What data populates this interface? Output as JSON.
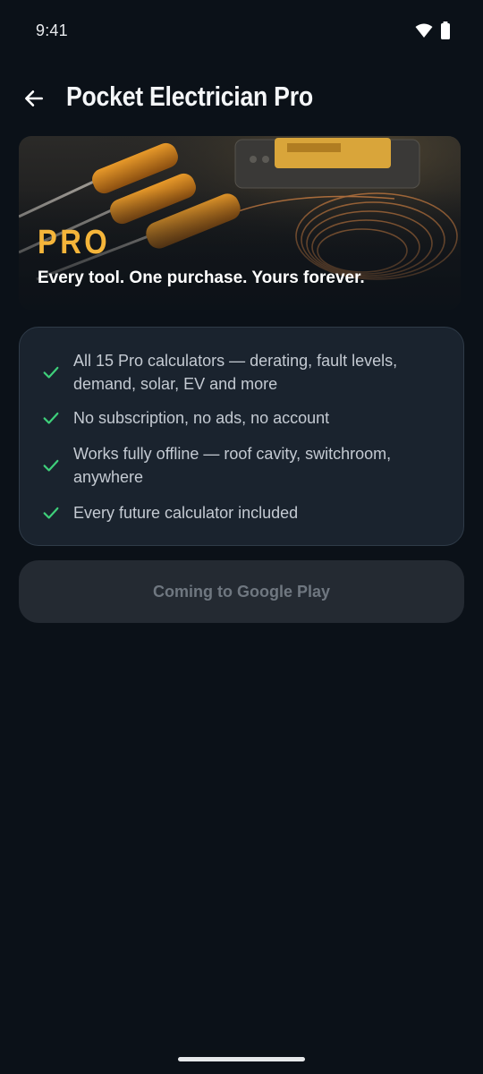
{
  "status_bar": {
    "time": "9:41",
    "icons": [
      "wifi-icon",
      "battery-icon"
    ]
  },
  "header": {
    "title": "Pocket Electrician Pro",
    "back_icon": "arrow-left-icon"
  },
  "hero": {
    "badge": "PRO",
    "tagline": "Every tool. One purchase. Yours forever."
  },
  "features": {
    "icon": "check-icon",
    "items": [
      "All 15 Pro calculators — derating, fault levels, demand, solar, EV and more",
      "No subscription, no ads, no account",
      "Works fully offline — roof cavity, switchroom, anywhere",
      "Every future calculator included"
    ]
  },
  "cta": {
    "label": "Coming to Google Play",
    "enabled": false
  },
  "colors": {
    "background": "#0b1118",
    "accent": "#f5b53a",
    "check": "#3ecf7a",
    "card": "#1a232e"
  }
}
